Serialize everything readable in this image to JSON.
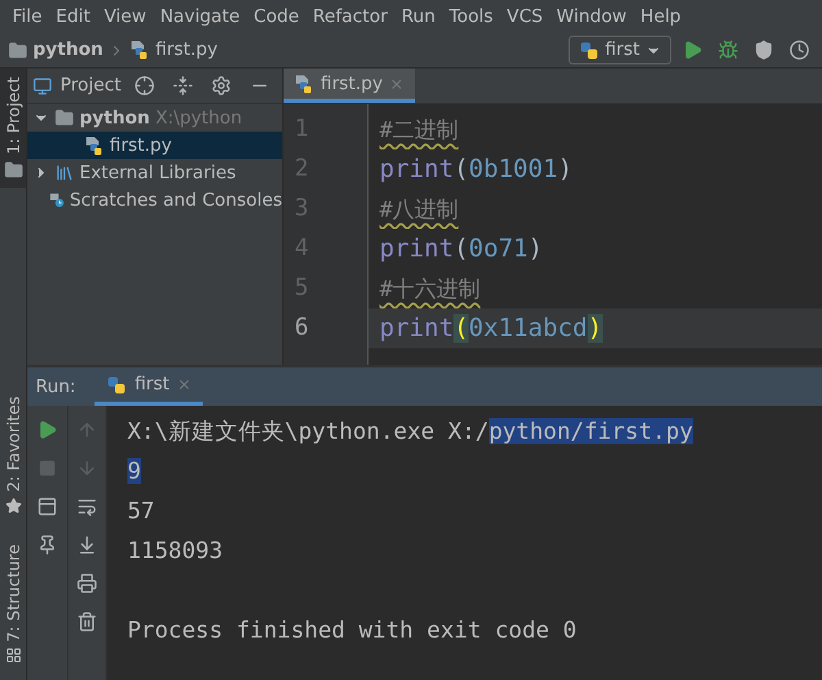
{
  "menu": [
    {
      "label": "File"
    },
    {
      "label": "Edit"
    },
    {
      "label": "View"
    },
    {
      "label": "Navigate"
    },
    {
      "label": "Code"
    },
    {
      "label": "Refactor"
    },
    {
      "label": "Run"
    },
    {
      "label": "Tools"
    },
    {
      "label": "VCS"
    },
    {
      "label": "Window"
    },
    {
      "label": "Help"
    }
  ],
  "breadcrumb": [
    {
      "label": "python",
      "kind": "folder"
    },
    {
      "label": "first.py",
      "kind": "pyfile"
    }
  ],
  "run_config": {
    "label": "first"
  },
  "tool_stripe": {
    "top": [
      {
        "label": "1: Project",
        "kind": "folder",
        "selected": true
      }
    ],
    "bottom": [
      {
        "label": "2: Favorites",
        "kind": "star",
        "selected": false
      },
      {
        "label": "7: Structure",
        "kind": "structure",
        "selected": false
      }
    ]
  },
  "project_panel": {
    "title": "Project",
    "tree": [
      {
        "label": "python",
        "hint": "X:\\python",
        "kind": "folder",
        "expanded": true,
        "selected": false,
        "children": [
          {
            "label": "first.py",
            "kind": "pyfile",
            "selected": true
          }
        ]
      },
      {
        "label": "External Libraries",
        "kind": "library",
        "expanded": false,
        "selected": false
      },
      {
        "label": "Scratches and Consoles",
        "kind": "scratch",
        "selected": false
      }
    ]
  },
  "editor": {
    "tabs": [
      {
        "label": "first.py",
        "selected": true
      }
    ],
    "lines": [
      {
        "number": "1",
        "current": false,
        "tokens": [
          {
            "text": "#二进制",
            "kind": "comment",
            "matched": false
          }
        ]
      },
      {
        "number": "2",
        "current": false,
        "tokens": [
          {
            "text": "print",
            "kind": "builtin",
            "matched": false
          },
          {
            "text": "(",
            "kind": "paren",
            "matched": false
          },
          {
            "text": "0b1001",
            "kind": "number",
            "matched": false
          },
          {
            "text": ")",
            "kind": "paren",
            "matched": false
          }
        ]
      },
      {
        "number": "3",
        "current": false,
        "tokens": [
          {
            "text": "#八进制",
            "kind": "comment",
            "matched": false
          }
        ]
      },
      {
        "number": "4",
        "current": false,
        "tokens": [
          {
            "text": "print",
            "kind": "builtin",
            "matched": false
          },
          {
            "text": "(",
            "kind": "paren",
            "matched": false
          },
          {
            "text": "0o71",
            "kind": "number",
            "matched": false
          },
          {
            "text": ")",
            "kind": "paren",
            "matched": false
          }
        ]
      },
      {
        "number": "5",
        "current": false,
        "tokens": [
          {
            "text": "#十六进制",
            "kind": "comment",
            "matched": false
          }
        ]
      },
      {
        "number": "6",
        "current": true,
        "tokens": [
          {
            "text": "print",
            "kind": "builtin",
            "matched": false
          },
          {
            "text": "(",
            "kind": "paren",
            "matched": true
          },
          {
            "text": "0x11abcd",
            "kind": "number",
            "matched": false
          },
          {
            "text": ")",
            "kind": "paren",
            "matched": true
          }
        ]
      }
    ]
  },
  "run": {
    "label": "Run:",
    "tabs": [
      {
        "label": "first",
        "selected": true
      }
    ],
    "console": [
      {
        "kind": "output",
        "segments": [
          {
            "text": "X:\\新建文件夹\\python.exe X:/",
            "selected": false
          },
          {
            "text": "python/first.py",
            "selected": true
          }
        ]
      },
      {
        "kind": "output",
        "segments": [
          {
            "text": "9",
            "selected": true
          }
        ]
      },
      {
        "kind": "output",
        "segments": [
          {
            "text": "57",
            "selected": false
          }
        ]
      },
      {
        "kind": "output",
        "segments": [
          {
            "text": "1158093",
            "selected": false
          }
        ]
      },
      {
        "kind": "status",
        "segments": [
          {
            "text": "Process finished with exit code 0",
            "selected": false
          }
        ]
      }
    ]
  }
}
